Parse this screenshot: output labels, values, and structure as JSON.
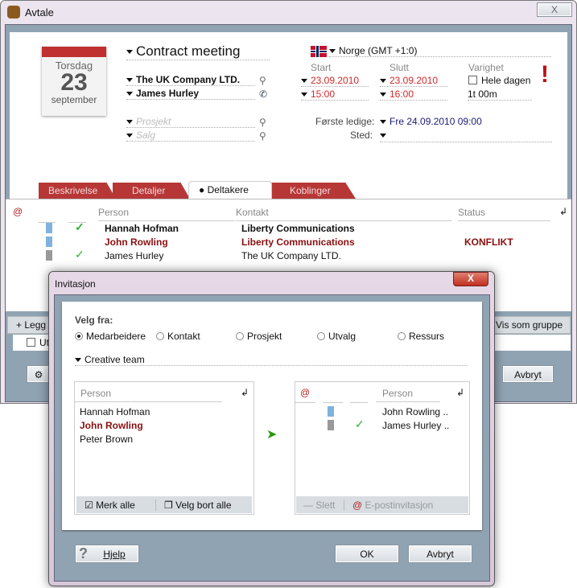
{
  "window": {
    "title": "Avtale",
    "close": "X"
  },
  "calendar": {
    "weekday": "Torsdag",
    "day": "23",
    "month": "september"
  },
  "appointment": {
    "title": "Contract meeting",
    "company": "The UK Company LTD.",
    "contact": "James Hurley",
    "project_placeholder": "Prosjekt",
    "sale_placeholder": "Salg"
  },
  "timezone": {
    "label": "Norge (GMT +1:0)"
  },
  "time": {
    "start_label": "Start",
    "end_label": "Slutt",
    "duration_label": "Varighet",
    "start_date": "23.09.2010",
    "end_date": "23.09.2010",
    "start_time": "15:00",
    "end_time": "16:00",
    "all_day_label": "Hele dagen",
    "all_day_checked": false,
    "duration": "1t 00m",
    "first_free_label": "Første ledige:",
    "first_free_value": "Fre 24.09.2010 09:00",
    "place_label": "Sted:"
  },
  "tabs": [
    {
      "label": "Beskrivelse"
    },
    {
      "label": "Detaljer"
    },
    {
      "label": "Deltakere",
      "active": true
    },
    {
      "label": "Koblinger"
    }
  ],
  "participants": {
    "headers": {
      "email": "@",
      "person": "Person",
      "contact": "Kontakt",
      "status": "Status"
    },
    "rows": [
      {
        "person": "Hannah Hofman",
        "contact": "Liberty Communications",
        "status": "",
        "icon": "person-blue",
        "accepted": true
      },
      {
        "person": "John Rowling",
        "contact": "Liberty Communications",
        "status": "KONFLIKT",
        "icon": "person-blue",
        "accepted": false
      },
      {
        "person": "James Hurley",
        "contact": "The UK Company LTD.",
        "status": "",
        "icon": "person-grey",
        "accepted": true
      }
    ],
    "add_label": "Legg",
    "group_label": "Vis som gruppe",
    "checkbox_label": "Ut"
  },
  "main_buttons": {
    "cancel": "Avbryt"
  },
  "dialog": {
    "title": "Invitasjon",
    "close": "X",
    "select_from": "Velg fra:",
    "radios": [
      {
        "label": "Medarbeidere",
        "checked": true
      },
      {
        "label": "Kontakt"
      },
      {
        "label": "Prosjekt"
      },
      {
        "label": "Utvalg"
      },
      {
        "label": "Ressurs"
      }
    ],
    "group": "Creative team",
    "left": {
      "header": "Person",
      "items": [
        "Hannah Hofman",
        "John Rowling",
        "Peter Brown"
      ],
      "select_all": "Merk alle",
      "deselect_all": "Velg bort alle"
    },
    "right": {
      "email_header": "@",
      "header": "Person",
      "items": [
        {
          "name": "John Rowling ..",
          "icon": "person-blue",
          "accepted": false
        },
        {
          "name": "James Hurley ..",
          "icon": "person-grey",
          "accepted": true
        }
      ],
      "delete": "Slett",
      "email_invite": "E-postinvitasjon"
    },
    "help": "Hjelp",
    "ok": "OK",
    "cancel": "Avbryt"
  },
  "colors": {
    "accent": "#b73737",
    "conflict": "#8b0f0f",
    "frame": "#8fa3b3",
    "accepted": "#2db52d"
  }
}
